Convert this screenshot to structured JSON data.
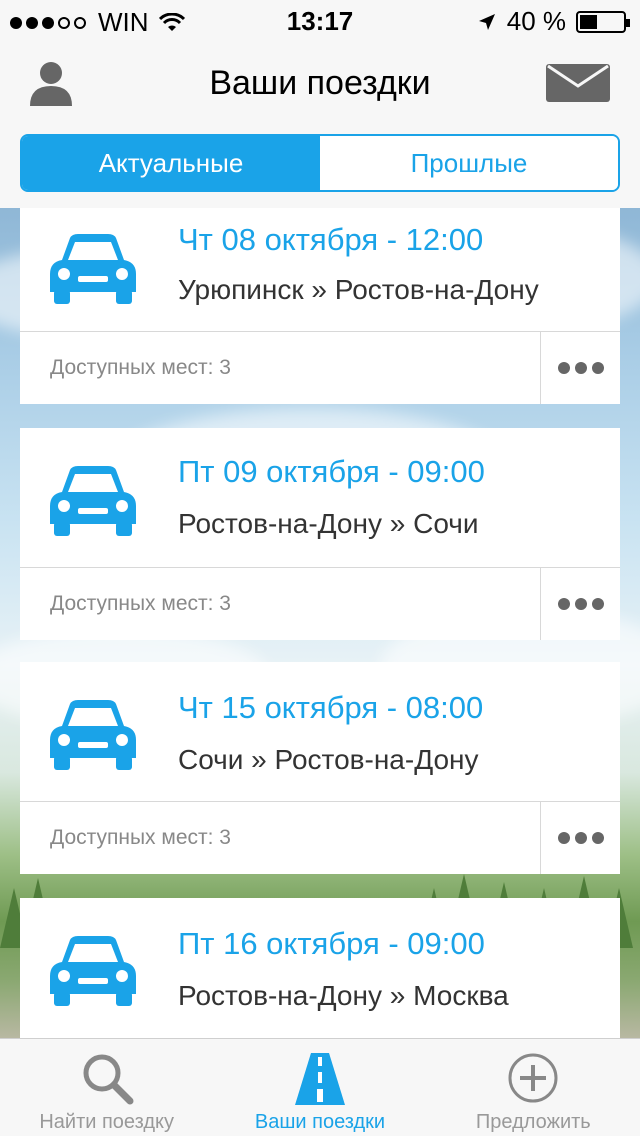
{
  "status_bar": {
    "carrier": "WIN",
    "time": "13:17",
    "battery": "40 %",
    "battery_level": 0.4
  },
  "header": {
    "title": "Ваши поездки",
    "left_icon": "user-icon",
    "right_icon": "mail-icon"
  },
  "tabs": {
    "current": "Актуальные",
    "past": "Прошлые"
  },
  "trips": [
    {
      "date": "Чт 08 октября - 12:00",
      "route": "Урюпинск » Ростов-на-Дону",
      "seats": "Доступных мест: 3"
    },
    {
      "date": "Пт 09 октября - 09:00",
      "route": "Ростов-на-Дону » Сочи",
      "seats": "Доступных мест: 3"
    },
    {
      "date": "Чт 15 октября - 08:00",
      "route": "Сочи » Ростов-на-Дону",
      "seats": "Доступных мест: 3"
    },
    {
      "date": "Пт 16 октября - 09:00",
      "route": "Ростов-на-Дону » Москва",
      "seats": ""
    }
  ],
  "tab_bar": {
    "find": "Найти поездку",
    "mine": "Ваши поездки",
    "offer": "Предложить"
  },
  "colors": {
    "accent": "#1aa3e8",
    "text": "#333333",
    "muted": "#888888"
  }
}
